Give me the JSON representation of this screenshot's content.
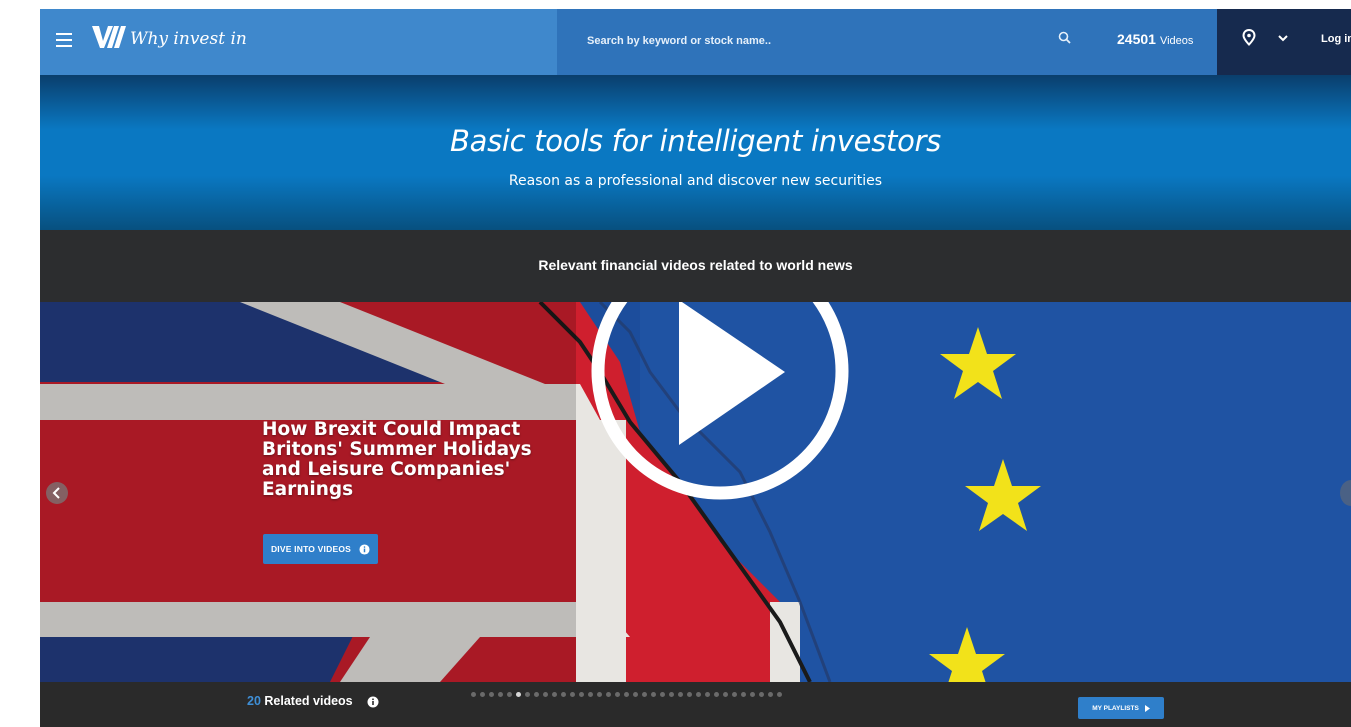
{
  "header": {
    "logo_text": "Why invest in",
    "search_placeholder": "Search by keyword or stock name..",
    "video_count": "24501",
    "video_count_label": "Videos",
    "login_label": "Log in"
  },
  "hero": {
    "title": "Basic tools for intelligent investors",
    "subtitle": "Reason as a professional and discover new securities"
  },
  "news": {
    "title": "Relevant financial videos related to world news"
  },
  "slide": {
    "heading": "How Brexit Could Impact Britons' Summer Holidays and Leisure Companies' Earnings",
    "button_label": "DIVE INTO VIDEOS"
  },
  "bottom": {
    "related_count": "20",
    "related_label": "Related videos",
    "playlists_label": "MY PLAYLISTS",
    "carousel_total": 35,
    "carousel_active": 5
  },
  "colors": {
    "brand_blue": "#3f88cc",
    "search_blue": "#2f73ba",
    "navy": "#162a4e",
    "button_blue": "#2f7fca",
    "eu_blue": "#1b4a9a",
    "eu_star": "#f2e21a",
    "uk_red": "#cf1f2e"
  },
  "icons": [
    "hamburger-menu-icon",
    "logo-mark-icon",
    "search-icon",
    "location-pin-icon",
    "chevron-down-icon",
    "info-icon",
    "play-icon",
    "arrow-left-icon",
    "arrow-right-icon",
    "caret-right-icon"
  ]
}
